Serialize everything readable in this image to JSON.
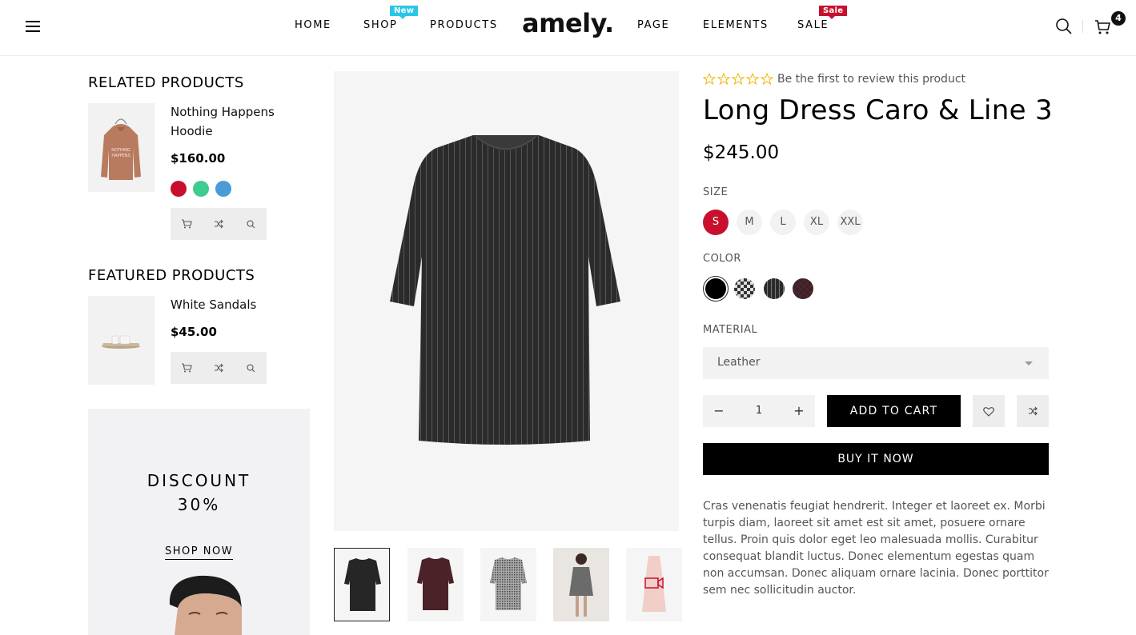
{
  "header": {
    "logo": "amely.",
    "nav": [
      "HOME",
      "SHOP",
      "PRODUCTS",
      "PAGE",
      "ELEMENTS",
      "SALE"
    ],
    "badges": {
      "shop": "New",
      "sale": "Sale"
    },
    "cart_count": "4",
    "icons": [
      "menu-icon",
      "search-icon",
      "cart-icon"
    ]
  },
  "sidebar": {
    "related_title": "RELATED PRODUCTS",
    "related": {
      "name": "Nothing Happens Hoodie",
      "price": "$160.00",
      "thumb_text": "NOTHING HAPPENS",
      "colors": [
        "#c8102e",
        "#3fcc8f",
        "#4a9bd6"
      ]
    },
    "featured_title": "FEATURED PRODUCTS",
    "featured": {
      "name": "White Sandals",
      "price": "$45.00"
    },
    "banner": {
      "title_line1": "DISCOUNT",
      "title_line2": "30%",
      "link": "SHOP NOW"
    }
  },
  "product": {
    "review_text": "Be the first to review this product",
    "rating": 0,
    "title": "Long Dress Caro & Line 3",
    "price": "$245.00",
    "size_label": "SIZE",
    "sizes": [
      "S",
      "M",
      "L",
      "XL",
      "XXL"
    ],
    "selected_size": "S",
    "color_label": "COLOR",
    "colors": [
      "black",
      "gingham",
      "dark-stripe",
      "burgundy-check"
    ],
    "material_label": "MATERIAL",
    "material_value": "Leather",
    "quantity": "1",
    "qty_minus": "−",
    "qty_plus": "+",
    "add_to_cart": "ADD TO CART",
    "buy_now": "BUY IT NOW",
    "description": "Cras venenatis feugiat hendrerit. Integer et laoreet ex. Morbi turpis diam, laoreet sit amet est sit amet, posuere ornare tellus. Proin quis dolor eget leo malesuada mollis. Curabitur consequat blandit luctus. Donec elementum egestas quam non accumsan. Donec aliquam ornare lacinia. Donec porttitor sem nec sollicitudin auctor."
  },
  "colors": {
    "accent_red": "#c8102e",
    "accent_cyan": "#29c6e6",
    "button_black": "#000000",
    "star": "#f5b301"
  }
}
